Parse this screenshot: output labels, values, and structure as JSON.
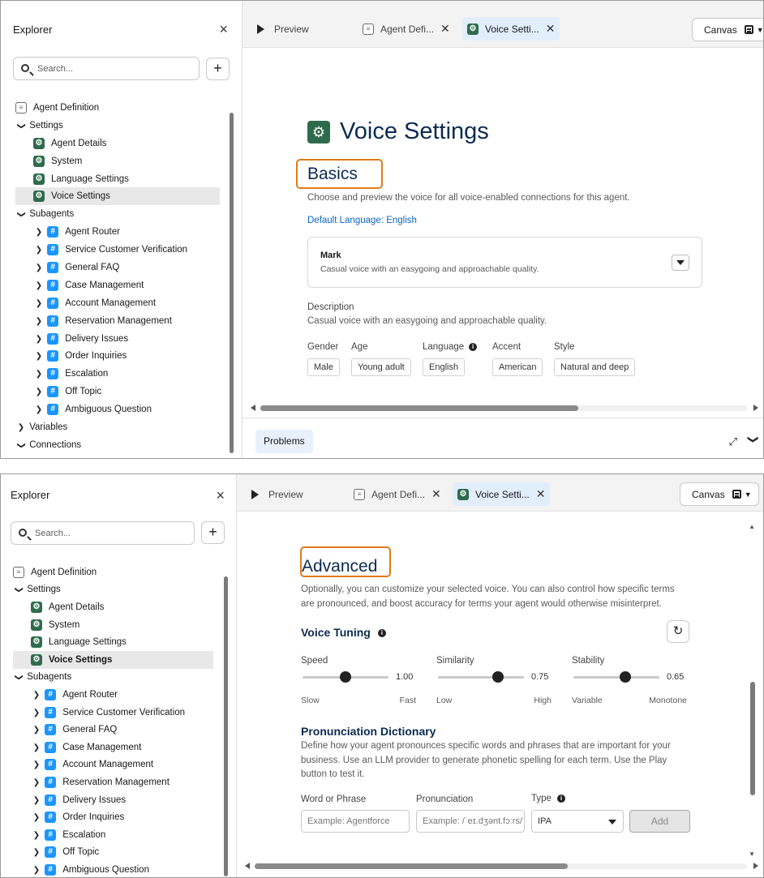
{
  "explorer": {
    "title": "Explorer",
    "close_glyph": "×",
    "search_placeholder": "Search...",
    "add_glyph": "+"
  },
  "tree_top": [
    {
      "label": "Agent Definition"
    },
    {
      "label": "Settings"
    },
    {
      "label": "Agent Details"
    },
    {
      "label": "System"
    },
    {
      "label": "Language Settings"
    },
    {
      "label": "Voice Settings"
    },
    {
      "label": "Subagents"
    },
    {
      "label": "Agent Router"
    },
    {
      "label": "Service Customer Verification"
    },
    {
      "label": "General FAQ"
    },
    {
      "label": "Case Management"
    },
    {
      "label": "Account Management"
    },
    {
      "label": "Reservation Management"
    },
    {
      "label": "Delivery Issues"
    },
    {
      "label": "Order Inquiries"
    },
    {
      "label": "Escalation"
    },
    {
      "label": "Off Topic"
    },
    {
      "label": "Ambiguous Question"
    },
    {
      "label": "Variables"
    },
    {
      "label": "Connections"
    }
  ],
  "tabs": {
    "preview": "Preview",
    "agent_def": "Agent Defi...",
    "voice": "Voice Setti...",
    "close_glyph": "✕",
    "canvas": "Canvas"
  },
  "basics": {
    "page_title": "Voice Settings",
    "section_title": "Basics",
    "intro": "Choose and preview the voice for all voice-enabled connections for this agent.",
    "default_language_link": "Default Language: English",
    "voice_name": "Mark",
    "voice_desc": "Casual voice with an easygoing and approachable quality.",
    "description_label": "Description",
    "description_text": "Casual voice with an easygoing and approachable quality.",
    "attrs": {
      "gender_label": "Gender",
      "gender": "Male",
      "age_label": "Age",
      "age": "Young adult",
      "language_label": "Language",
      "language": "English",
      "accent_label": "Accent",
      "accent": "American",
      "style_label": "Style",
      "style": "Natural and deep"
    },
    "problems": "Problems"
  },
  "advanced": {
    "section_title": "Advanced",
    "intro": "Optionally, you can customize your selected voice. You can also control how specific terms are pronounced, and boost accuracy for terms your agent would otherwise misinterpret.",
    "tuning_title": "Voice Tuning",
    "reset_glyph": "↻",
    "sliders": [
      {
        "label": "Speed",
        "value": "1.00",
        "low": "Slow",
        "high": "Fast",
        "level": 0.5
      },
      {
        "label": "Similarity",
        "value": "0.75",
        "low": "Low",
        "high": "High",
        "level": 0.7
      },
      {
        "label": "Stability",
        "value": "0.65",
        "low": "Variable",
        "high": "Monotone",
        "level": 0.6
      }
    ],
    "dictionary_title": "Pronunciation Dictionary",
    "dictionary_intro": "Define how your agent pronounces specific words and phrases that are important for your business. Use an LLM provider to generate phonetic spelling for each term. Use the Play button to test it.",
    "word_label": "Word or Phrase",
    "word_placeholder": "Example: Agentforce",
    "pron_label": "Pronunciation",
    "pron_placeholder": "Example: /ˈeɪ.dʒənt.fɔːrs/",
    "type_label": "Type",
    "type_value": "IPA",
    "add_label": "Add"
  },
  "colors": {
    "accent_orange": "#e07b1a",
    "title_navy": "#0b2b52",
    "gear_green": "#2e6b4d",
    "hash_blue": "#1b96ff",
    "link_blue": "#0a66c2"
  }
}
